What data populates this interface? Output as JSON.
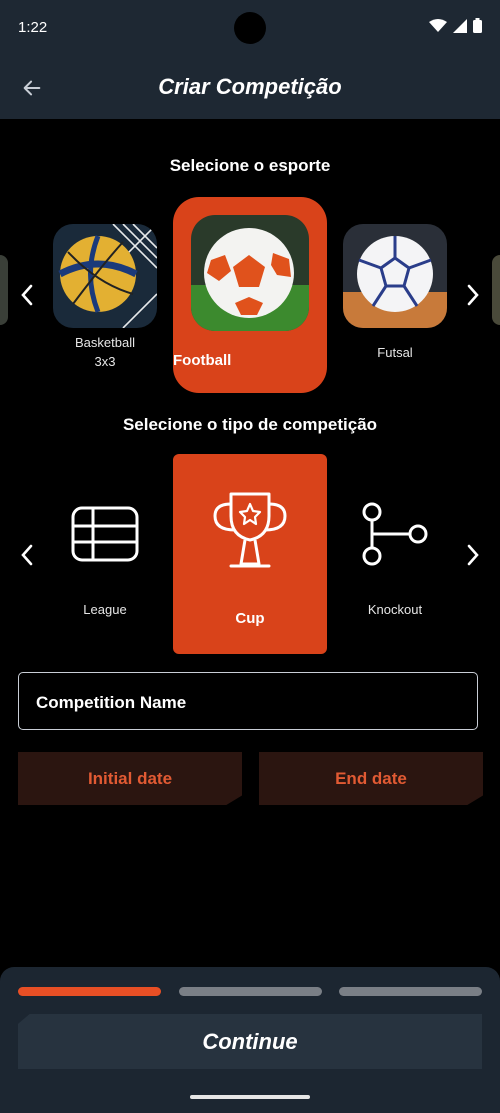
{
  "status_bar": {
    "time": "1:22"
  },
  "header": {
    "title": "Criar Competição"
  },
  "sport_section": {
    "title": "Selecione o esporte",
    "items": [
      {
        "label": "Basketball\n3x3"
      },
      {
        "label": "Football"
      },
      {
        "label": "Futsal"
      }
    ],
    "selected": "Football"
  },
  "competition_section": {
    "title": "Selecione o tipo de competição",
    "items": [
      {
        "label": "League"
      },
      {
        "label": "Cup"
      },
      {
        "label": "Knockout"
      }
    ],
    "selected": "Cup"
  },
  "form": {
    "name_placeholder": "Competition Name",
    "initial_date_label": "Initial date",
    "end_date_label": "End date"
  },
  "footer": {
    "continue_label": "Continue",
    "steps_total": 3,
    "current_step": 1
  },
  "colors": {
    "accent": "#d9431a",
    "appbar": "#1e2833",
    "background": "#000000",
    "step_active": "#e84f25",
    "step_inactive": "#7a7f86"
  }
}
